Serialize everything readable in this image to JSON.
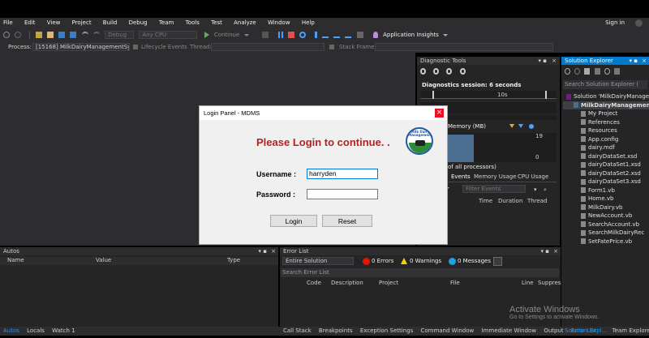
{
  "menu": [
    "File",
    "Edit",
    "View",
    "Project",
    "Build",
    "Debug",
    "Team",
    "Tools",
    "Test",
    "Analyze",
    "Window",
    "Help"
  ],
  "sign_in": "Sign in",
  "toolbar": {
    "config": "Debug",
    "platform": "Any CPU",
    "continue": "Continue",
    "app_insights": "Application Insights"
  },
  "process_bar": {
    "process_label": "Process:",
    "process_value": "[15168] MilkDairyManagementSys",
    "lifecycle": "Lifecycle Events",
    "thread_label": "Thread:",
    "stack_frame": "Stack Frame:"
  },
  "diagnostic": {
    "title": "Diagnostic Tools",
    "session": "Diagnostics session: 6 seconds",
    "tick": "10s",
    "memory_label": "Memory (MB)",
    "scale_top": "19",
    "scale_bottom": "0",
    "processors": "of all processors)",
    "tabs": [
      "Events",
      "Memory Usage",
      "CPU Usage"
    ],
    "filter": "Filter Events",
    "cols": [
      "Time",
      "Duration",
      "Thread"
    ]
  },
  "solution": {
    "title": "Solution Explorer",
    "search": "Search Solution Explorer (",
    "items": [
      {
        "label": "Solution 'MilkDairyManage",
        "indent": 0
      },
      {
        "label": "MilkDairyManagemen",
        "indent": 1,
        "bold": true
      },
      {
        "label": "My Project",
        "indent": 2
      },
      {
        "label": "References",
        "indent": 2
      },
      {
        "label": "Resources",
        "indent": 2
      },
      {
        "label": "App.config",
        "indent": 2
      },
      {
        "label": "dairy.mdf",
        "indent": 2
      },
      {
        "label": "dairyDataSet.xsd",
        "indent": 2
      },
      {
        "label": "dairyDataSet1.xsd",
        "indent": 2
      },
      {
        "label": "dairyDataSet2.xsd",
        "indent": 2
      },
      {
        "label": "dairyDataSet3.xsd",
        "indent": 2
      },
      {
        "label": "Form1.vb",
        "indent": 2
      },
      {
        "label": "Home.vb",
        "indent": 2
      },
      {
        "label": "MilkDairy.vb",
        "indent": 2
      },
      {
        "label": "NewAccount.vb",
        "indent": 2
      },
      {
        "label": "SearchAccount.vb",
        "indent": 2
      },
      {
        "label": "SearchMilkDairyRec",
        "indent": 2
      },
      {
        "label": "SetFatePrice.vb",
        "indent": 2
      }
    ]
  },
  "login": {
    "window_title": "Login Panel - MDMS",
    "heading": "Please Login to continue. .",
    "logo_text": "Milk Dairy Management",
    "username_label": "Username :",
    "username_value": "harryden",
    "password_label": "Password :",
    "password_value": "",
    "login_button": "Login",
    "reset_button": "Reset",
    "close": "×"
  },
  "autos": {
    "title": "Autos",
    "cols": [
      "Name",
      "Value",
      "Type"
    ]
  },
  "errors": {
    "title": "Error List",
    "scope": "Entire Solution",
    "errors": "0 Errors",
    "warnings": "0 Warnings",
    "messages": "0 Messages",
    "search": "Search Error List",
    "cols": [
      "Code",
      "Description",
      "Project",
      "File",
      "Line",
      "Suppres"
    ]
  },
  "watermark": {
    "line1": "Activate Windows",
    "line2": "Go to Settings to activate Windows."
  },
  "status_left": [
    "Autos",
    "Locals",
    "Watch 1"
  ],
  "status_mid": [
    "Call Stack",
    "Breakpoints",
    "Exception Settings",
    "Command Window",
    "Immediate Window",
    "Output",
    "Error List"
  ],
  "status_right": [
    "Solution Expl...",
    "Team Explorer"
  ],
  "colors": {
    "accent": "#007acc",
    "heading_red": "#b22222",
    "error_red": "#e51400",
    "warning_yellow": "#ffcc00",
    "info_blue": "#1ba1e2",
    "vs_purple": "#68217a"
  }
}
